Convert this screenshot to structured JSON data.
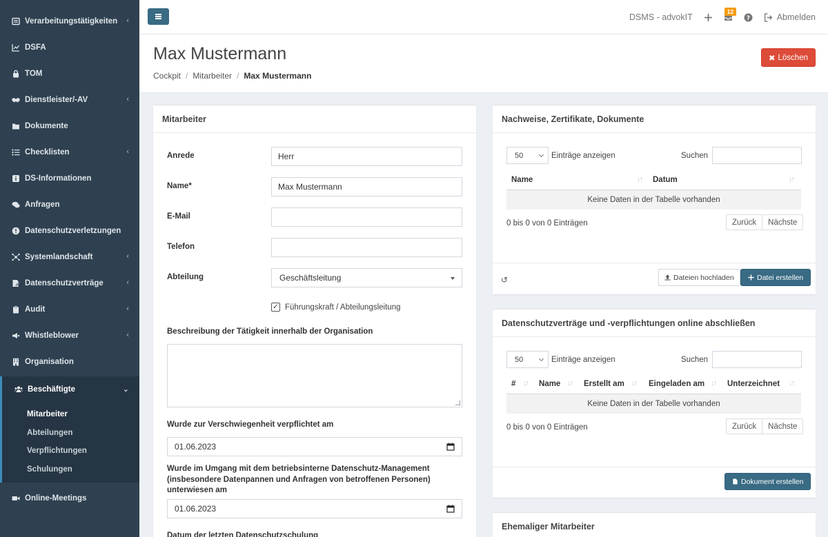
{
  "sidebar": {
    "items": [
      {
        "label": "Verarbeitungstätigkeiten",
        "icon": "list-icon",
        "chevron": true
      },
      {
        "label": "DSFA",
        "icon": "chart-line-icon",
        "chevron": false
      },
      {
        "label": "TOM",
        "icon": "lock-icon",
        "chevron": false
      },
      {
        "label": "Dienstleister/-AV",
        "icon": "handshake-icon",
        "chevron": true
      },
      {
        "label": "Dokumente",
        "icon": "folder-icon",
        "chevron": false
      },
      {
        "label": "Checklisten",
        "icon": "checklist-icon",
        "chevron": true
      },
      {
        "label": "DS-Informationen",
        "icon": "info-square-icon",
        "chevron": false
      },
      {
        "label": "Anfragen",
        "icon": "comments-icon",
        "chevron": false
      },
      {
        "label": "Datenschutzverletzungen",
        "icon": "exclamation-circle-icon",
        "chevron": false
      },
      {
        "label": "Systemlandschaft",
        "icon": "network-icon",
        "chevron": true
      },
      {
        "label": "Datenschutzverträge",
        "icon": "contract-icon",
        "chevron": true
      },
      {
        "label": "Audit",
        "icon": "clipboard-icon",
        "chevron": true
      },
      {
        "label": "Whistleblower",
        "icon": "megaphone-icon",
        "chevron": true
      },
      {
        "label": "Organisation",
        "icon": "building-icon",
        "chevron": false
      },
      {
        "label": "Beschäftigte",
        "icon": "users-icon",
        "chevron": true
      }
    ],
    "subitems": [
      "Mitarbeiter",
      "Abteilungen",
      "Verpflichtungen",
      "Schulungen"
    ],
    "last_item": {
      "label": "Online-Meetings",
      "icon": "video-icon"
    }
  },
  "topbar": {
    "org_label": "DSMS - advokIT",
    "notification_count": "12",
    "logout_label": "Abmelden"
  },
  "header": {
    "title": "Max Mustermann",
    "breadcrumb": [
      "Cockpit",
      "Mitarbeiter",
      "Max Mustermann"
    ],
    "delete_label": "Löschen"
  },
  "form": {
    "box_title": "Mitarbeiter",
    "anrede_label": "Anrede",
    "anrede_value": "Herr",
    "name_label": "Name*",
    "name_value": "Max Mustermann",
    "email_label": "E-Mail",
    "email_value": "",
    "telefon_label": "Telefon",
    "telefon_value": "",
    "abteilung_label": "Abteilung",
    "abteilung_value": "Geschäftsleitung",
    "fuehrungskraft_label": "Führungskraft / Abteilungsleitung",
    "fuehrungskraft_checked": true,
    "beschreibung_label": "Beschreibung der Tätigkeit innerhalb der Organisation",
    "verschwiegenheit_label": "Wurde zur Verschwiegenheit verpflichtet am",
    "verschwiegenheit_value": "01.06.2023",
    "unterwiesen_label": "Wurde im Umgang mit dem betriebsinterne Datenschutz-Management (insbesondere Datenpannen und Anfragen von betroffenen Personen) unterwiesen am",
    "unterwiesen_value": "01.06.2023",
    "schulung_label": "Datum der letzten Datenschutzschulung"
  },
  "nachweise": {
    "title": "Nachweise, Zertifikate, Dokumente",
    "length_value": "50",
    "length_label": "Einträge anzeigen",
    "search_label": "Suchen",
    "columns": [
      "Name",
      "Datum"
    ],
    "empty_text": "Keine Daten in der Tabelle vorhanden",
    "info": "0 bis 0 von 0 Einträgen",
    "prev_label": "Zurück",
    "next_label": "Nächste",
    "upload_label": "Dateien hochladen",
    "create_label": "Datei erstellen"
  },
  "vertraege": {
    "title": "Datenschutzverträge und -verpflichtungen online abschließen",
    "length_value": "50",
    "length_label": "Einträge anzeigen",
    "search_label": "Suchen",
    "columns": [
      "#",
      "Name",
      "Erstellt am",
      "Eingeladen am",
      "Unterzeichnet"
    ],
    "empty_text": "Keine Daten in der Tabelle vorhanden",
    "info": "0 bis 0 von 0 Einträgen",
    "prev_label": "Zurück",
    "next_label": "Nächste",
    "create_label": "Dokument erstellen"
  },
  "ehemalig": {
    "title": "Ehemaliger Mitarbeiter"
  },
  "colors": {
    "sidebar_bg": "#2f4050",
    "primary": "#3a6b84",
    "danger": "#dd4b39",
    "badge": "#f39c12"
  }
}
